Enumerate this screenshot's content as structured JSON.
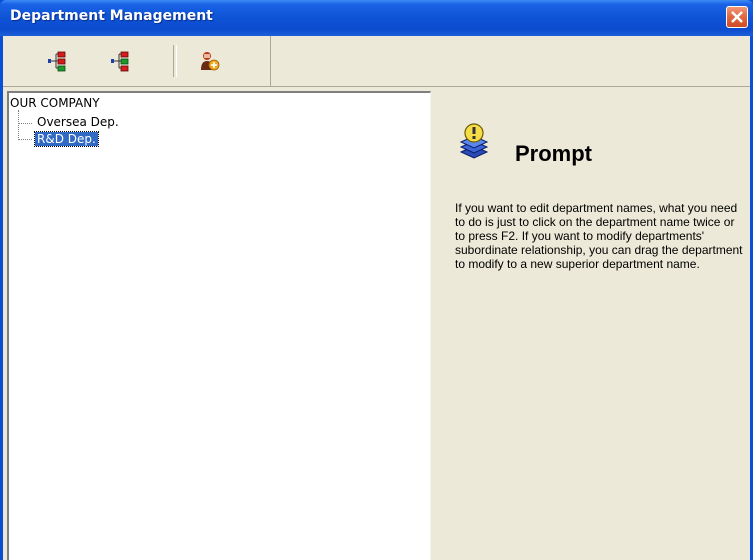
{
  "window": {
    "title": "Department Management",
    "close_label": "Close"
  },
  "toolbar": {
    "buttons": [
      {
        "icon": "add-department-icon"
      },
      {
        "icon": "add-subdepartment-icon"
      },
      {
        "icon": "delete-department-icon"
      }
    ]
  },
  "tree": {
    "root": "OUR COMPANY",
    "children": [
      {
        "label": "Oversea Dep.",
        "selected": false
      },
      {
        "label": "R&D Dep.",
        "selected": true
      }
    ]
  },
  "prompt": {
    "title": "Prompt",
    "icon": "lightbulb-stack-icon",
    "text": "If you want to edit department names, what you need to do is just to click on the department name twice or to press F2. If you want to modify departments' subordinate relationship, you can drag the department to modify to a new superior department name."
  },
  "colors": {
    "titlebar": "#0b4bcf",
    "selection": "#316ac5",
    "face": "#ece9d8"
  }
}
